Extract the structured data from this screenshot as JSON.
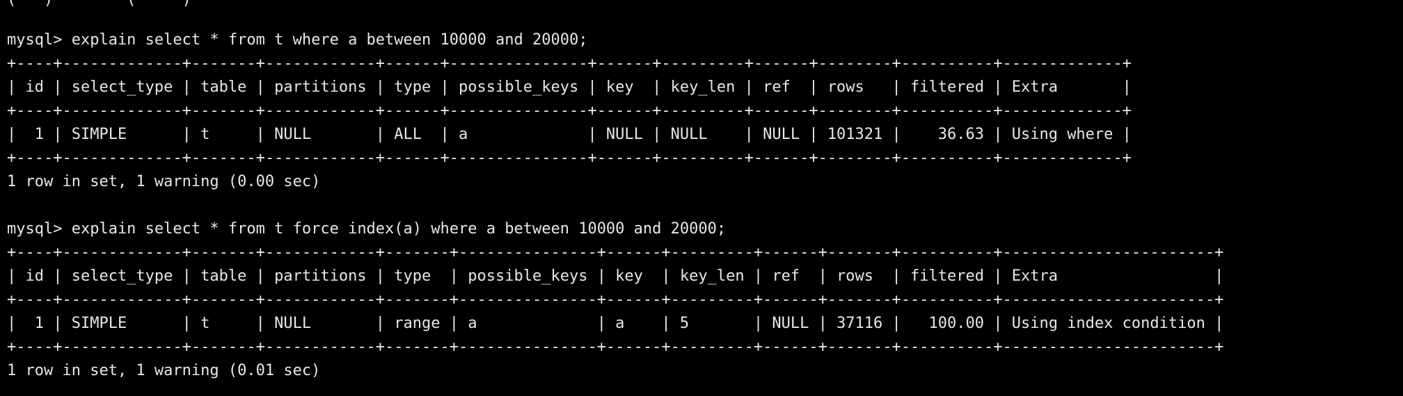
{
  "terminal": {
    "top_cut_line": "(   )        (     )",
    "session1": {
      "prompt": "mysql> explain select * from t where a between 10000 and 20000;",
      "border": "+----+-------------+-------+------------+------+---------------+------+---------+------+--------+----------+-------------+",
      "header": "| id | select_type | table | partitions | type | possible_keys | key  | key_len | ref  | rows   | filtered | Extra       |",
      "row": "|  1 | SIMPLE      | t     | NULL       | ALL  | a             | NULL | NULL    | NULL | 101321 |    36.63 | Using where |",
      "summary": "1 row in set, 1 warning (0.00 sec)"
    },
    "session2": {
      "prompt": "mysql> explain select * from t force index(a) where a between 10000 and 20000;",
      "border": "+----+-------------+-------+------------+-------+---------------+------+---------+------+-------+----------+-----------------------+",
      "header": "| id | select_type | table | partitions | type  | possible_keys | key  | key_len | ref  | rows  | filtered | Extra                 |",
      "row": "|  1 | SIMPLE      | t     | NULL       | range | a             | a    | 5       | NULL | 37116 |   100.00 | Using index condition |",
      "summary": "1 row in set, 1 warning (0.01 sec)"
    }
  }
}
